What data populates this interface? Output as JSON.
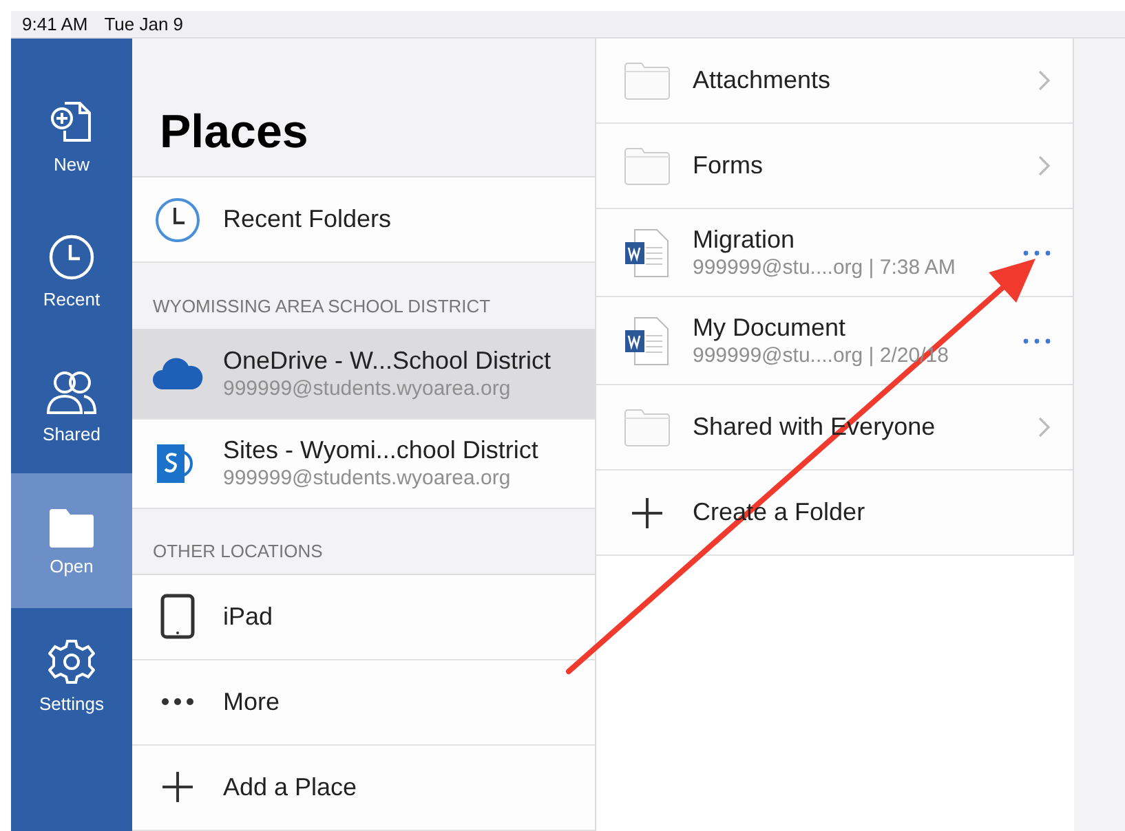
{
  "status_bar": {
    "time": "9:41 AM",
    "date": "Tue Jan 9"
  },
  "sidebar": {
    "items": [
      {
        "label": "New",
        "selected": false
      },
      {
        "label": "Recent",
        "selected": false
      },
      {
        "label": "Shared",
        "selected": false
      },
      {
        "label": "Open",
        "selected": true
      },
      {
        "label": "Settings",
        "selected": false
      }
    ]
  },
  "places": {
    "title": "Places",
    "sections": [
      {
        "items": [
          {
            "label": "Recent Folders",
            "selected": false
          }
        ]
      },
      {
        "header": "WYOMISSING AREA SCHOOL DISTRICT",
        "items": [
          {
            "label": "OneDrive - W...School District",
            "sublabel": "999999@students.wyoarea.org",
            "selected": true
          },
          {
            "label": "Sites - Wyomi...chool District",
            "sublabel": "999999@students.wyoarea.org",
            "selected": false
          }
        ]
      },
      {
        "header": "OTHER LOCATIONS",
        "items": [
          {
            "label": "iPad",
            "selected": false
          },
          {
            "label": "More",
            "selected": false
          }
        ]
      },
      {
        "items": [
          {
            "label": "Add a Place",
            "selected": false
          }
        ]
      }
    ]
  },
  "files": [
    {
      "kind": "folder",
      "name": "Attachments"
    },
    {
      "kind": "folder",
      "name": "Forms"
    },
    {
      "kind": "document",
      "name": "Migration",
      "detail": "999999@stu....org | 7:38 AM"
    },
    {
      "kind": "document",
      "name": "My Document",
      "detail": "999999@stu....org | 2/20/18"
    },
    {
      "kind": "folder",
      "name": "Shared with Everyone"
    },
    {
      "kind": "action",
      "name": "Create a Folder"
    }
  ]
}
